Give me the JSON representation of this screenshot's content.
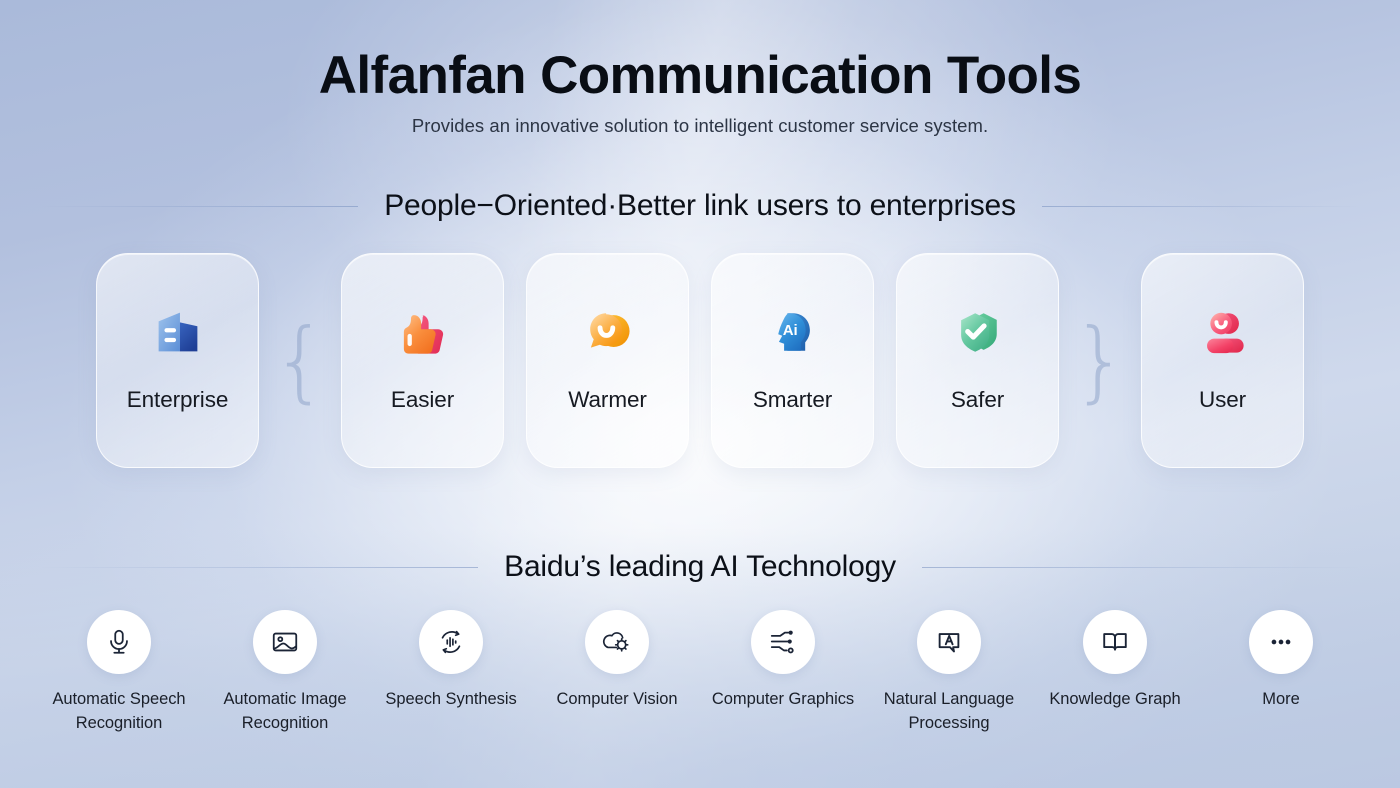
{
  "header": {
    "title": "Alfanfan Communication Tools",
    "subtitle": "Provides an innovative solution to intelligent customer service system."
  },
  "people_section": {
    "heading": "People−Oriented·Better link users to enterprises",
    "left_brace": "{",
    "right_brace": "}",
    "cards": [
      {
        "label": "Enterprise",
        "icon": "enterprise-building-icon",
        "color": "#2f5fc0"
      },
      {
        "label": "Easier",
        "icon": "thumbs-up-icon",
        "color": "#f5833a"
      },
      {
        "label": "Warmer",
        "icon": "smiling-chat-bubble-icon",
        "color": "#f9a825"
      },
      {
        "label": "Smarter",
        "icon": "ai-head-icon",
        "color": "#2b8fd6"
      },
      {
        "label": "Safer",
        "icon": "shield-check-icon",
        "color": "#57bf96"
      },
      {
        "label": "User",
        "icon": "user-avatar-icon",
        "color": "#ef4a6a"
      }
    ]
  },
  "ai_section": {
    "heading": "Baidu’s leading AI Technology",
    "items": [
      {
        "label": "Automatic Speech Recognition",
        "icon": "microphone-icon"
      },
      {
        "label": "Automatic Image Recognition",
        "icon": "image-picture-icon"
      },
      {
        "label": "Speech Synthesis",
        "icon": "waveform-refresh-icon"
      },
      {
        "label": "Computer Vision",
        "icon": "cloud-gear-icon"
      },
      {
        "label": "Computer Graphics",
        "icon": "circuit-nodes-icon"
      },
      {
        "label": "Natural Language Processing",
        "icon": "speech-bubble-a-icon"
      },
      {
        "label": "Knowledge Graph",
        "icon": "open-book-icon"
      },
      {
        "label": "More",
        "icon": "ellipsis-icon"
      }
    ]
  },
  "theme": {
    "background_top": "#aabada",
    "background_mid": "#cfd9ec",
    "text_primary": "#090d14",
    "icon_stroke": "#1b2436"
  }
}
